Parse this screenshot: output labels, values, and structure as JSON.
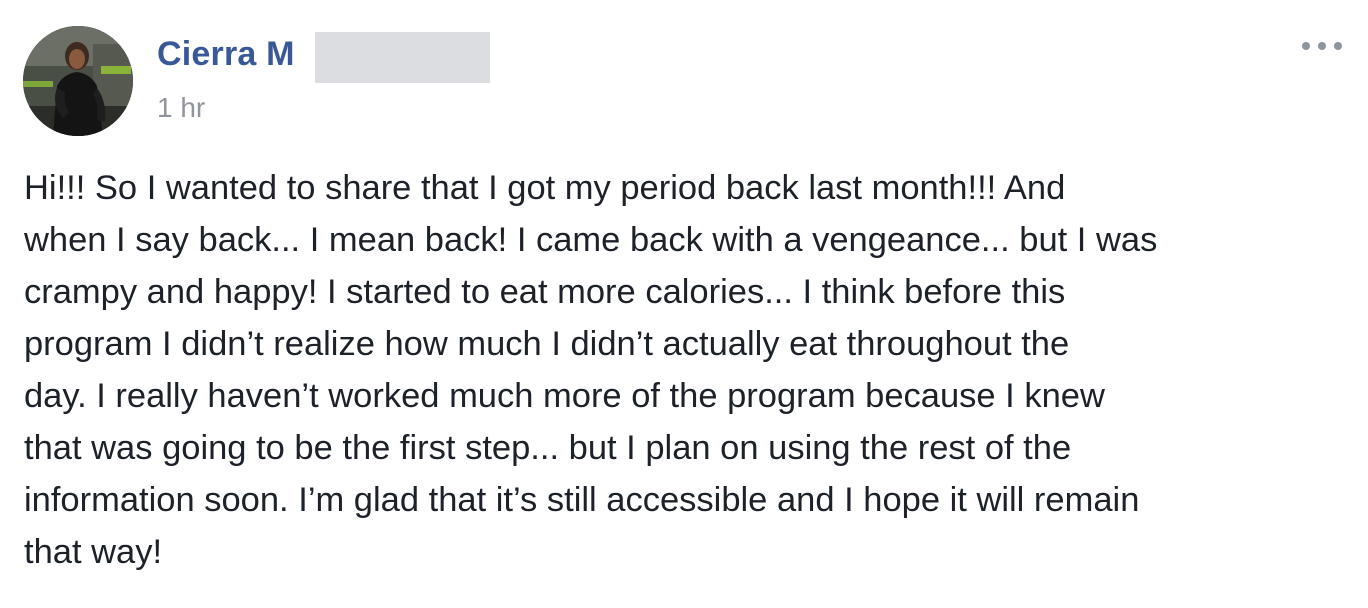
{
  "post": {
    "author_name": "Cierra M",
    "timestamp": "1 hr",
    "more_icon": "ellipsis-icon",
    "avatar_icon": "profile-photo",
    "body_lines": [
      "Hi!!! So I wanted to share that I got my period back last month!!! And",
      "when I say back... I mean back! I came back with a vengeance... but I was",
      "crampy and happy! I started to eat more calories... I think before this",
      "program I didn’t realize how much I didn’t actually eat throughout the",
      "day. I really haven’t worked much more of the program because I knew",
      "that was going to be the first step... but I plan on using the rest of the",
      "information soon. I’m glad that it’s still accessible and I hope it will remain",
      "that way!"
    ]
  },
  "colors": {
    "author_link": "#385898",
    "timestamp": "#90949c",
    "body_text": "#1d2129",
    "redaction": "#dcdde0"
  }
}
